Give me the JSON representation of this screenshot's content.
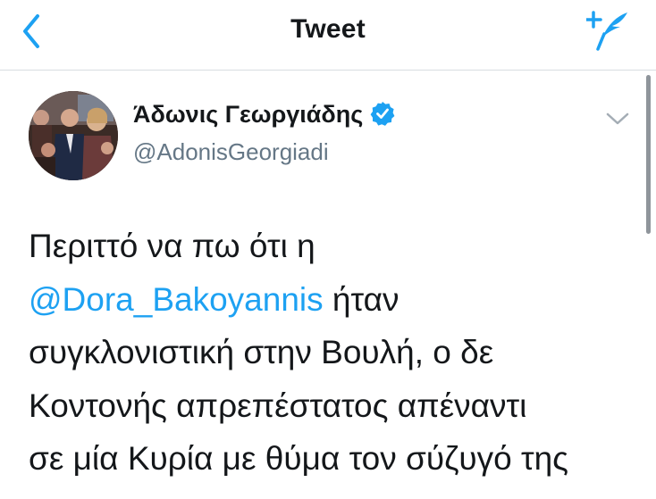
{
  "navbar": {
    "title": "Tweet",
    "back_icon": "chevron-left-icon",
    "compose_icon": "compose-feather-icon",
    "accent_color": "#1da1f2"
  },
  "tweet": {
    "author_name": "Άδωνις Γεωργιάδης",
    "author_handle": "@AdonisGeorgiadi",
    "verified": true,
    "text_lines": [
      {
        "before": "Περιττό να πω ότι η",
        "mention": "",
        "after": ""
      },
      {
        "before": "",
        "mention": "@Dora_Bakoyannis",
        "after": " ήταν"
      },
      {
        "before": "συγκλονιστική στην Βουλή, ο δε",
        "mention": "",
        "after": ""
      },
      {
        "before": "Κοντονής απρεπέστατος απέναντι",
        "mention": "",
        "after": ""
      },
      {
        "before": "σε μία Κυρία με θύμα τον σύζυγό της",
        "mention": "",
        "after": ""
      }
    ],
    "mention_color": "#1da1f2",
    "text_color": "#14171a",
    "handle_color": "#657786"
  }
}
